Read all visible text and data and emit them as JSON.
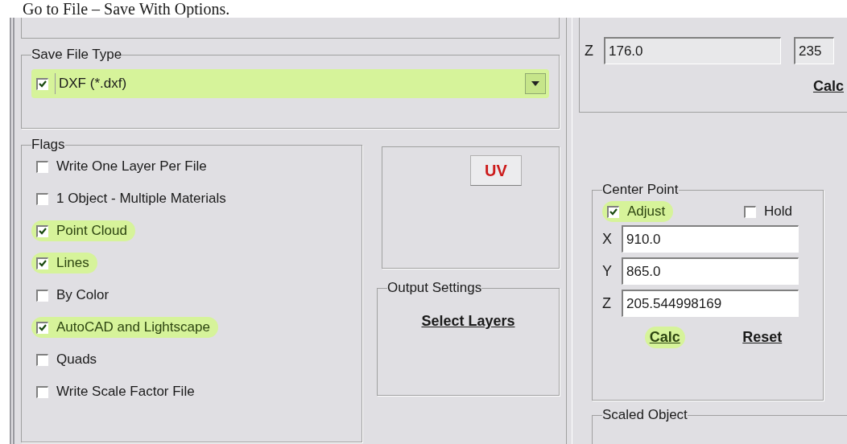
{
  "caption": "Go to File – Save With Options.",
  "save_file_type": {
    "title": "Save File Type",
    "checked": true,
    "highlighted": true,
    "value": "DXF (*.dxf)"
  },
  "flags": {
    "title": "Flags",
    "items": [
      {
        "label": "Write One Layer Per File",
        "checked": false,
        "highlighted": false
      },
      {
        "label": "1 Object - Multiple Materials",
        "checked": false,
        "highlighted": false
      },
      {
        "label": "Point Cloud",
        "checked": true,
        "highlighted": true
      },
      {
        "label": "Lines",
        "checked": true,
        "highlighted": true
      },
      {
        "label": "By Color",
        "checked": false,
        "highlighted": false
      },
      {
        "label": "AutoCAD and Lightscape",
        "checked": true,
        "highlighted": true
      },
      {
        "label": "Quads",
        "checked": false,
        "highlighted": false
      },
      {
        "label": "Write Scale Factor File",
        "checked": false,
        "highlighted": false
      }
    ]
  },
  "uv_button": "UV",
  "output_settings": {
    "title": "Output Settings",
    "link": "Select Layers"
  },
  "top_right": {
    "axis": "Z",
    "fields": [
      "176.0",
      "235"
    ],
    "calc": "Calc"
  },
  "center_point": {
    "title": "Center Point",
    "options": [
      {
        "label": "Adjust",
        "checked": true,
        "highlighted": true
      },
      {
        "label": "Hold",
        "checked": false,
        "highlighted": false
      }
    ],
    "coords": [
      {
        "axis": "X",
        "value": "910.0"
      },
      {
        "axis": "Y",
        "value": "865.0"
      },
      {
        "axis": "Z",
        "value": "205.544998169"
      }
    ],
    "buttons": [
      {
        "label": "Calc",
        "highlighted": true
      },
      {
        "label": "Reset",
        "highlighted": false
      }
    ]
  },
  "scaled_object": {
    "title": "Scaled Object"
  }
}
